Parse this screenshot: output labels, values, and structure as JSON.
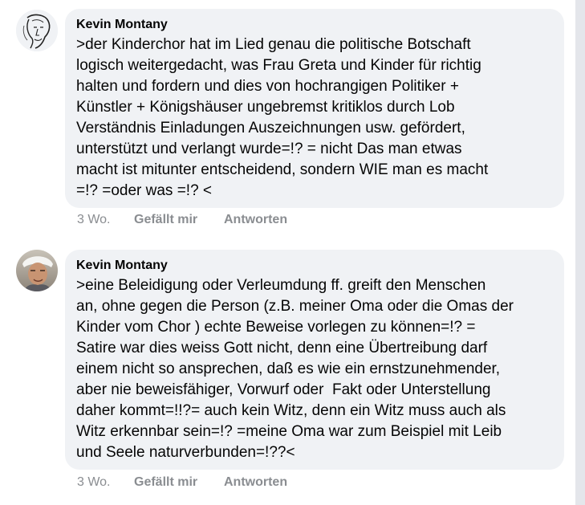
{
  "comments": [
    {
      "author": "Kevin Montany",
      "avatar_icon": "sketch-face-avatar",
      "text": ">der Kinderchor hat im Lied genau die politische Botschaft\nlogisch weitergedacht, was Frau Greta und Kinder für richtig\nhalten und fordern und dies von hochrangigen Politiker +\nKünstler + Königshäuser ungebremst kritiklos durch Lob\nVerständnis Einladungen Auszeichnungen usw. gefördert,\nunterstützt und verlangt wurde=!? = nicht Das man etwas\nmacht ist mitunter entscheidend, sondern WIE man es macht\n=!? =oder was =!? <",
      "time": "3 Wo.",
      "like_label": "Gefällt mir",
      "reply_label": "Antworten"
    },
    {
      "author": "Kevin Montany",
      "avatar_icon": "photo-avatar",
      "text": ">eine Beleidigung oder Verleumdung ff. greift den Menschen\nan, ohne gegen die Person (z.B. meiner Oma oder die Omas der\nKinder vom Chor ) echte Beweise vorlegen zu können=!? =\nSatire war dies weiss Gott nicht, denn eine Übertreibung darf\neinem nicht so ansprechen, daß es wie ein ernstzunehmender,\naber nie beweisfähiger, Vorwurf oder  Fakt oder Unterstellung\ndaher kommt=!!?= auch kein Witz, denn ein Witz muss auch als\nWitz erkennbar sein=!? =meine Oma war zum Beispiel mit Leib\nund Seele naturverbunden=!??<",
      "time": "3 Wo.",
      "like_label": "Gefällt mir",
      "reply_label": "Antworten"
    }
  ],
  "colors": {
    "bubble": "#f0f2f5",
    "meta_text": "#8a8d91",
    "body_text": "#050505"
  }
}
